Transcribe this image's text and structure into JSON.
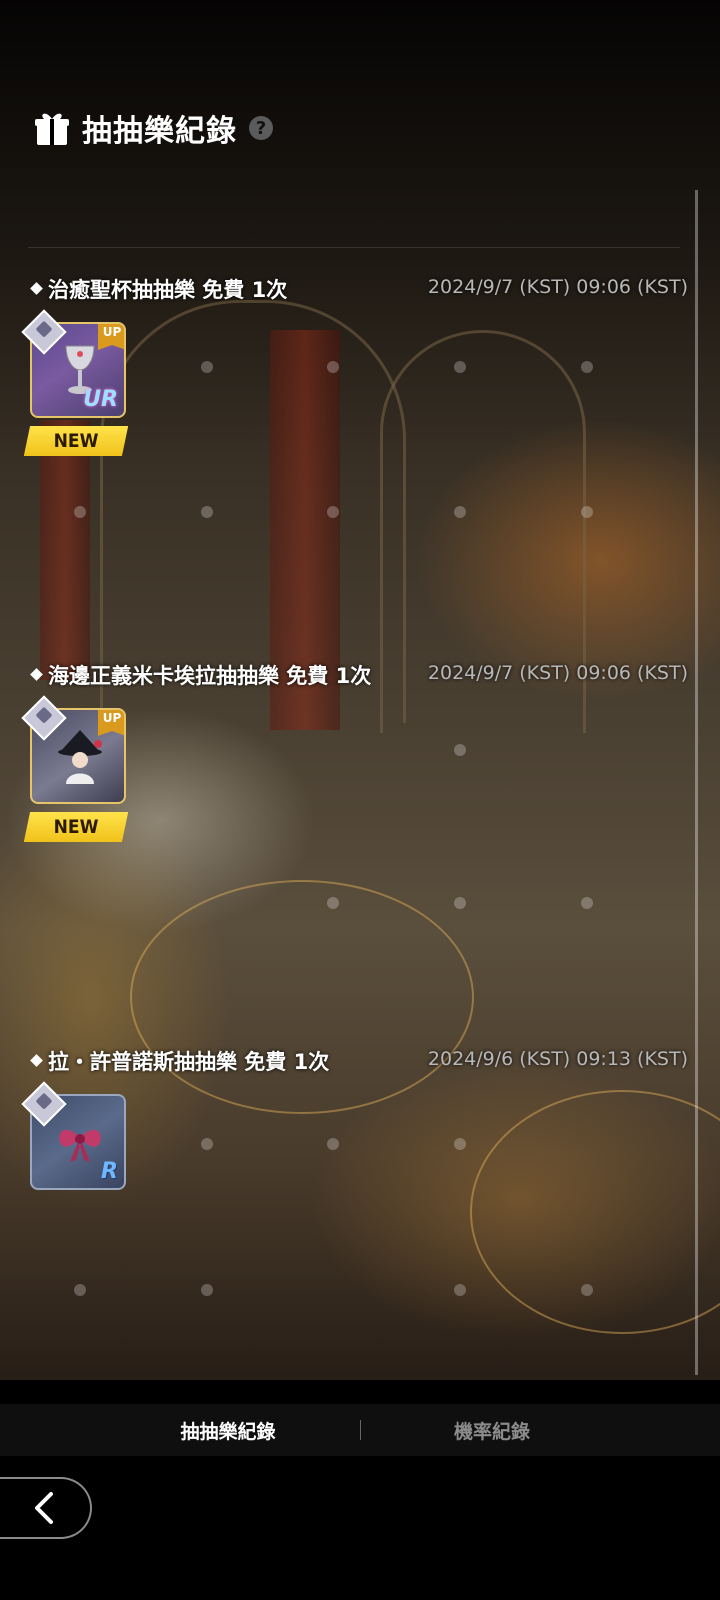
{
  "header": {
    "title": "抽抽樂紀錄",
    "help_symbol": "?",
    "icon": "gift-icon"
  },
  "records": [
    {
      "title": "治癒聖杯抽抽樂 免費 1次",
      "time": "2024/9/7 (KST) 09:06 (KST)",
      "item": {
        "rarity": "UR",
        "badge": "UP",
        "new_label": "NEW",
        "icon": "chalice-icon"
      }
    },
    {
      "title": "海邊正義米卡埃拉抽抽樂 免費 1次",
      "time": "2024/9/7 (KST) 09:06 (KST)",
      "item": {
        "rarity": "",
        "badge": "UP",
        "new_label": "NEW",
        "icon": "character-portrait-icon"
      }
    },
    {
      "title": "拉・許普諾斯抽抽樂 免費 1次",
      "time": "2024/9/6 (KST) 09:13 (KST)",
      "item": {
        "rarity": "R",
        "icon": "ribbon-icon"
      }
    }
  ],
  "tabs": [
    {
      "label": "抽抽樂紀錄",
      "active": true
    },
    {
      "label": "機率紀錄",
      "active": false
    }
  ],
  "nav": {
    "back_icon": "chevron-left-icon"
  },
  "colors": {
    "new_ribbon": "#f5cc24",
    "up_badge": "#d99a1e",
    "time_text": "#b8b8b8"
  }
}
